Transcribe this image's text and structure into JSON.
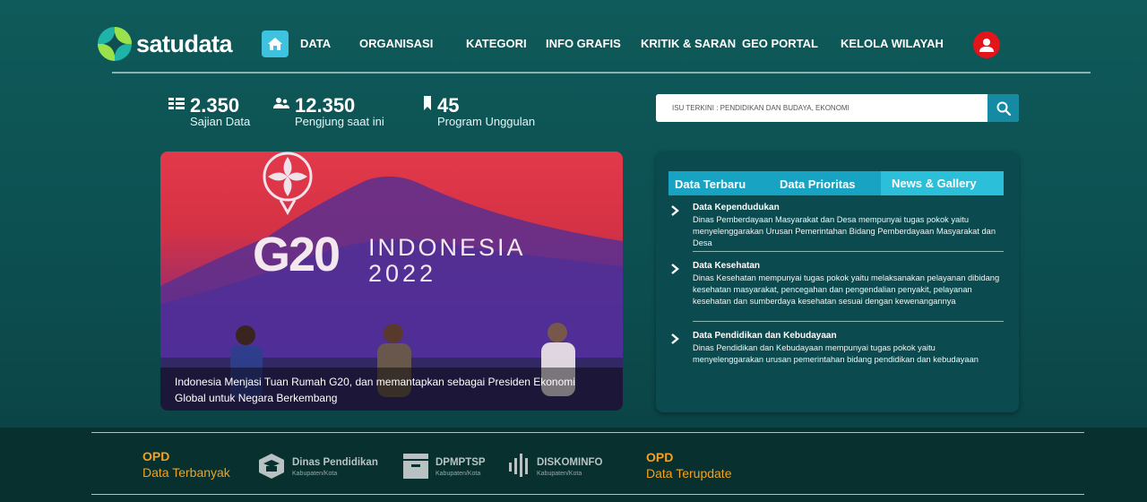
{
  "brand": {
    "name": "satudata"
  },
  "nav": {
    "items": [
      "DATA",
      "ORGANISASI",
      "KATEGORI",
      "INFO GRAFIS",
      "KRITIK & SARAN",
      "GEO PORTAL",
      "KELOLA WILAYAH"
    ]
  },
  "stats": [
    {
      "value": "2.350",
      "label": "Sajian Data",
      "icon": "list-grid-icon"
    },
    {
      "value": "12.350",
      "label": "Pengjung saat ini",
      "icon": "users-icon"
    },
    {
      "value": "45",
      "label": "Program Unggulan",
      "icon": "bookmark-icon"
    }
  ],
  "search": {
    "placeholder": "ISU TERKINI : PENDIDIKAN DAN BUDAYA, EKONOMI"
  },
  "hero": {
    "caption": "Indonesia Menjasi Tuan Rumah G20, dan memantapkan sebagai Presiden Ekonomi Global untuk Negara Berkembang",
    "logo_main": "G20",
    "logo_country": "INDONESIA",
    "logo_year": "2022"
  },
  "panel": {
    "tabs": [
      "Data Terbaru",
      "Data Prioritas",
      "News & Gallery"
    ],
    "items": [
      {
        "title": "Data Kependudukan",
        "desc": "Dinas Pemberdayaan Masyarakat dan Desa mempunyai tugas pokok yaitu menyelenggarakan Urusan Pemerintahan Bidang Pemberdayaan Masyarakat dan Desa"
      },
      {
        "title": "Data Kesehatan",
        "desc": "Dinas Kesehatan mempunyai tugas pokok yaitu melaksanakan pelayanan dibidang kesehatan masyarakat, pencegahan dan pengendalian penyakit, pelayanan kesehatan dan sumberdaya kesehatan sesuai dengan kewenangannya"
      },
      {
        "title": "Data Pendidikan dan Kebudayaan",
        "desc": "Dinas Pendidikan dan Kebudayaan mempunyai tugas pokok yaitu menyelenggarakan urusan pemerintahan bidang pendidikan dan kebudayaan"
      }
    ]
  },
  "footer": {
    "opd_left": {
      "label": "OPD",
      "sub": "Data Terbanyak"
    },
    "opd_right": {
      "label": "OPD",
      "sub": "Data Terupdate"
    },
    "partners": [
      {
        "name": "Dinas Pendidikan",
        "sub": "Kabupaten/Kota"
      },
      {
        "name": "DPMPTSP",
        "sub": "Kabupaten/Kota"
      },
      {
        "name": "DISKOMINFO",
        "sub": "Kabupaten/Kota"
      }
    ]
  },
  "colors": {
    "accent": "#19a3c3",
    "brand_green": "#9be14c",
    "alert_red": "#e3151b",
    "opd_orange": "#f4a21f"
  }
}
